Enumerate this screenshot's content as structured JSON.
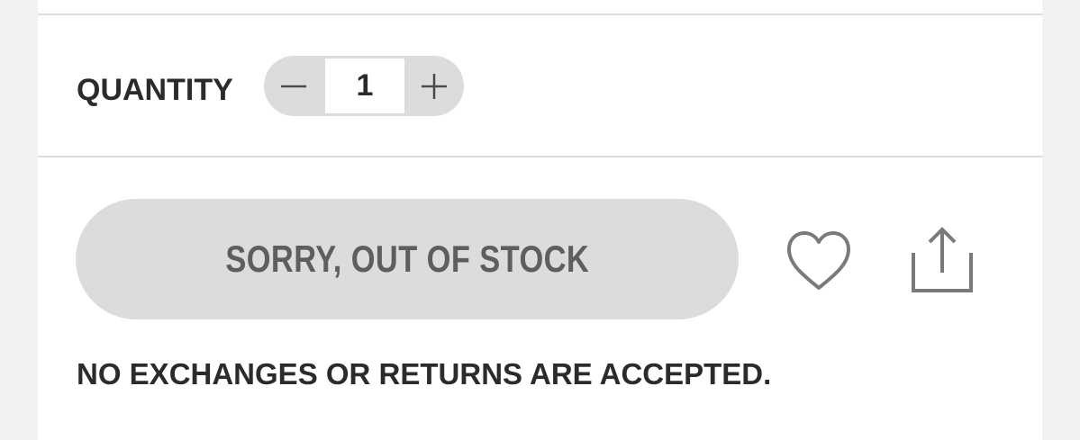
{
  "quantity": {
    "label": "QUANTITY",
    "value": "1",
    "decrement_icon": "minus-icon",
    "increment_icon": "plus-icon"
  },
  "actions": {
    "primary_label": "SORRY, OUT OF STOCK",
    "wishlist_icon": "heart-icon",
    "share_icon": "share-icon"
  },
  "policy_text": "NO EXCHANGES OR RETURNS ARE ACCEPTED.",
  "colors": {
    "background": "#f2f2f2",
    "panel": "#ffffff",
    "divider": "#dcdcdc",
    "control_fill": "#dcdcdc",
    "text_dark": "#2b2b2b",
    "text_muted": "#5e5e5e",
    "icon": "#7a7a7a"
  }
}
